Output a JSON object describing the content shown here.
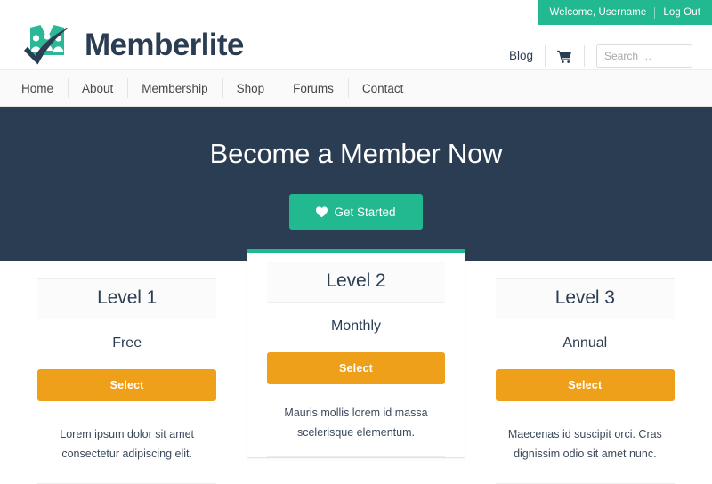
{
  "topbar": {
    "welcome_text": "Welcome, Username",
    "logout_label": "Log Out",
    "bg_color": "#22b890"
  },
  "header": {
    "brand_name": "Memberlite",
    "logo_icon": "memberlite-logo-icon",
    "blog_label": "Blog",
    "cart_icon": "shopping-cart-icon",
    "search_placeholder": "Search …",
    "search_value": ""
  },
  "nav": {
    "items": [
      {
        "label": "Home"
      },
      {
        "label": "About"
      },
      {
        "label": "Membership"
      },
      {
        "label": "Shop"
      },
      {
        "label": "Forums"
      },
      {
        "label": "Contact"
      }
    ]
  },
  "hero": {
    "title": "Become a Member Now",
    "cta_label": "Get Started",
    "cta_icon": "heart-icon",
    "bg_color": "#2b3d52",
    "cta_color": "#22b890"
  },
  "pricing": {
    "accent_color": "#efa01b",
    "featured_accent": "#22b890",
    "levels": [
      {
        "title": "Level 1",
        "price": "Free",
        "button_label": "Select",
        "description": "Lorem ipsum dolor sit amet consectetur adipiscing elit.",
        "featured": false
      },
      {
        "title": "Level 2",
        "price": "Monthly",
        "button_label": "Select",
        "description": "Mauris mollis lorem id massa scelerisque elementum.",
        "featured": true
      },
      {
        "title": "Level 3",
        "price": "Annual",
        "button_label": "Select",
        "description": "Maecenas id suscipit orci. Cras dignissim odio sit amet nunc.",
        "featured": false
      }
    ]
  }
}
